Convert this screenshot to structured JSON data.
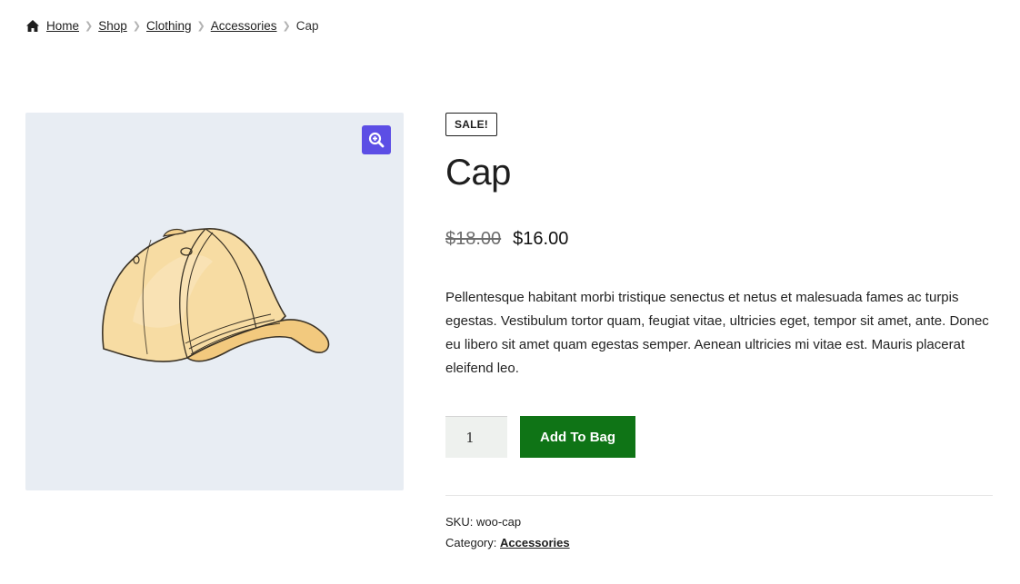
{
  "breadcrumb": {
    "items": [
      {
        "label": "Home",
        "link": true
      },
      {
        "label": "Shop",
        "link": true
      },
      {
        "label": "Clothing",
        "link": true
      },
      {
        "label": "Accessories",
        "link": true
      },
      {
        "label": "Cap",
        "link": false
      }
    ],
    "separator_icon": "chevron-right-icon",
    "home_icon": "home-icon"
  },
  "gallery": {
    "zoom_icon": "zoom-in-icon",
    "image_alt": "cap"
  },
  "product": {
    "badge": "SALE!",
    "title": "Cap",
    "price_old": "$18.00",
    "price_new": "$16.00",
    "description": "Pellentesque habitant morbi tristique senectus et netus et malesuada fames ac turpis egestas. Vestibulum tortor quam, feugiat vitae, ultricies eget, tempor sit amet, ante. Donec eu libero sit amet quam egestas semper. Aenean ultricies mi vitae est. Mauris placerat eleifend leo.",
    "quantity": "1",
    "add_button": "Add To Bag",
    "sku_label": "SKU:",
    "sku_value": "woo-cap",
    "category_label": "Category:",
    "category_value": "Accessories"
  },
  "colors": {
    "accent": "#5c4ee5",
    "button": "#0f7416",
    "gallery_bg": "#e8edf3"
  }
}
